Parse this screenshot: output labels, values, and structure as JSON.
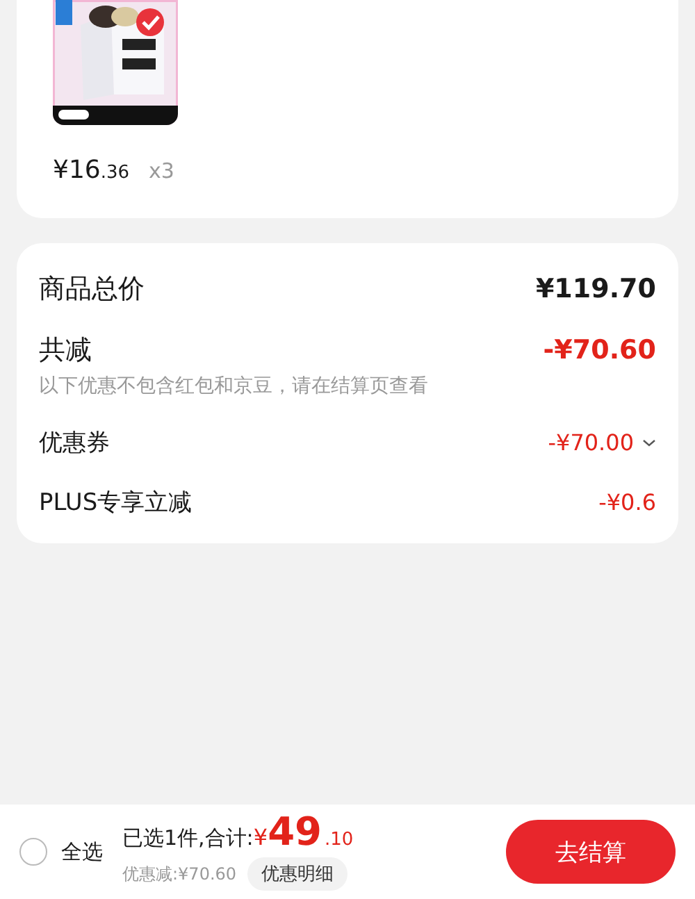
{
  "product": {
    "price_main": "¥16",
    "price_decimal": ".36",
    "quantity": "x3"
  },
  "summary": {
    "total_label": "商品总价",
    "total_value": "¥119.70",
    "discount_label": "共减",
    "discount_value": "-¥70.60",
    "note": "以下优惠不包含红包和京豆，请在结算页查看",
    "items": [
      {
        "label": "优惠券",
        "value": "-¥70.00",
        "expanded": false
      },
      {
        "label": "PLUS专享立减",
        "value": "-¥0.6"
      }
    ]
  },
  "footer": {
    "select_all": {
      "label": "全选",
      "checked": false
    },
    "selected_text": "已选1件,合计:",
    "currency": "¥",
    "amount_main": "49",
    "amount_decimal": ".10",
    "saved": "优惠减:¥70.60",
    "detail_button": "优惠明细",
    "checkout_button": "去结算"
  }
}
